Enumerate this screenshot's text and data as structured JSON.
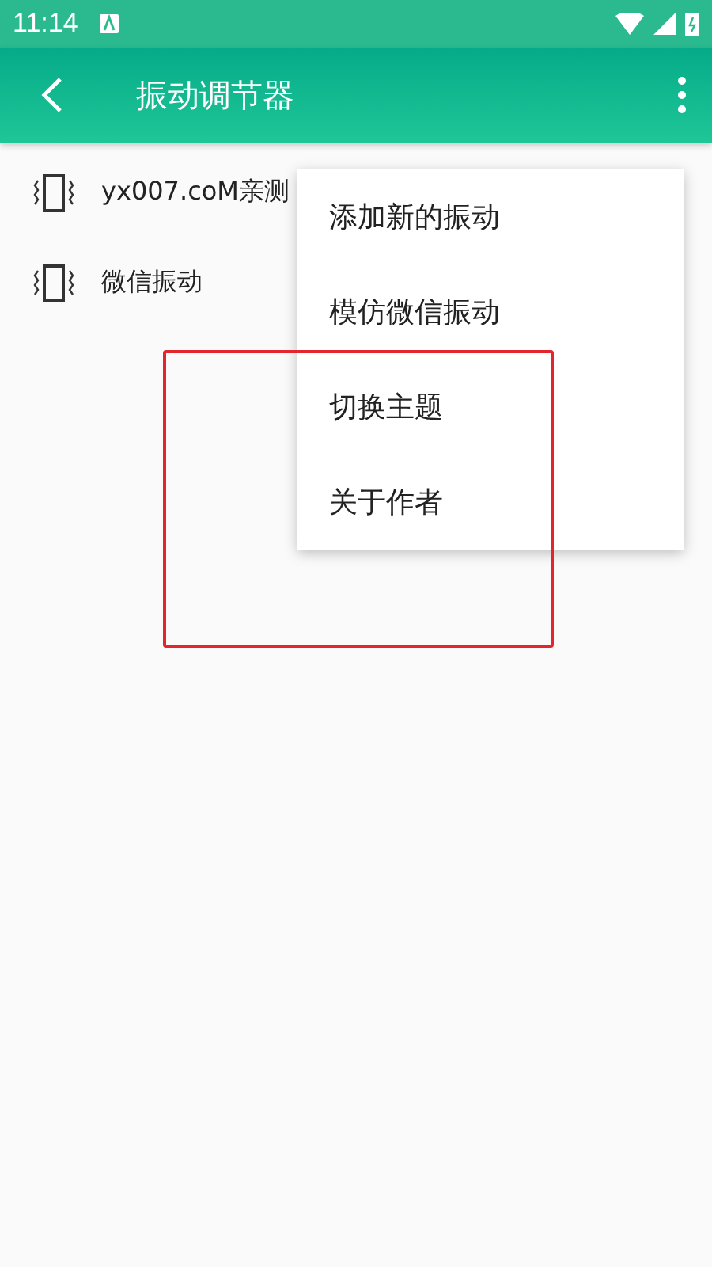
{
  "status_bar": {
    "time": "11:14"
  },
  "app_bar": {
    "title": "振动调节器"
  },
  "items": [
    {
      "name": "yx007.coM亲测"
    },
    {
      "name": "微信振动"
    }
  ],
  "menu": {
    "items": [
      {
        "label": "添加新的振动"
      },
      {
        "label": "模仿微信振动"
      },
      {
        "label": "切换主题"
      },
      {
        "label": "关于作者"
      }
    ]
  }
}
